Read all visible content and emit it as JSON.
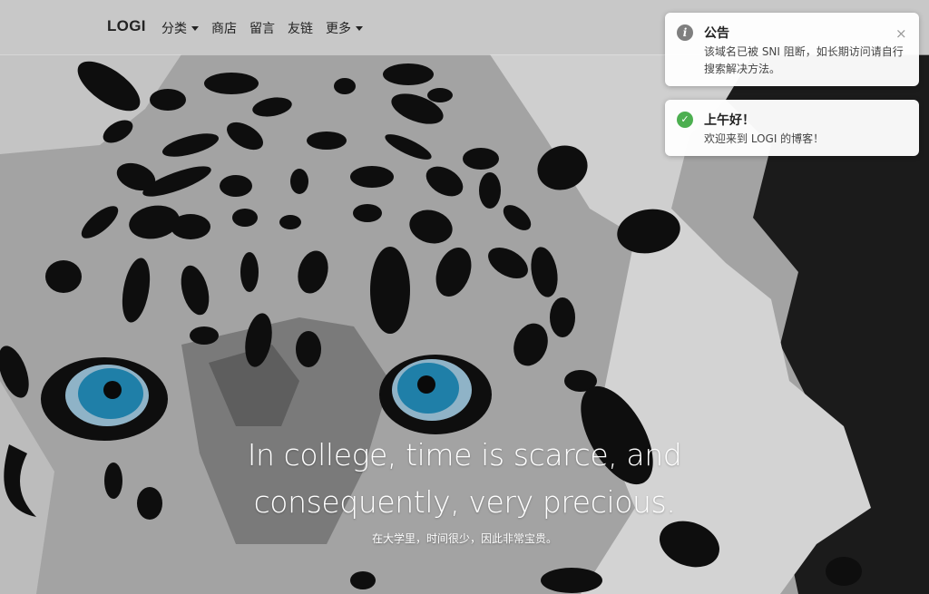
{
  "navbar": {
    "brand": "LOGI",
    "items": [
      {
        "label": "分类",
        "dropdown": true
      },
      {
        "label": "商店",
        "dropdown": false
      },
      {
        "label": "留言",
        "dropdown": false
      },
      {
        "label": "友链",
        "dropdown": false
      },
      {
        "label": "更多",
        "dropdown": true
      }
    ]
  },
  "hero": {
    "headline_line1": "In college, time is scarce, and",
    "headline_line2": "consequently, very precious.",
    "subline": "在大学里，时间很少，因此非常宝贵。"
  },
  "notifications": [
    {
      "icon": "info-icon",
      "title": "公告",
      "body": "该域名已被 SNI 阻断，如长期访问请自行搜索解决方法。",
      "close_glyph": "×"
    },
    {
      "icon": "check-circle-icon",
      "title": "上午好！",
      "body": "欢迎来到 LOGI 的博客！"
    }
  ],
  "colors": {
    "info": "#7f7f7f",
    "success": "#4caf50",
    "eye": "#1f7fa8"
  }
}
